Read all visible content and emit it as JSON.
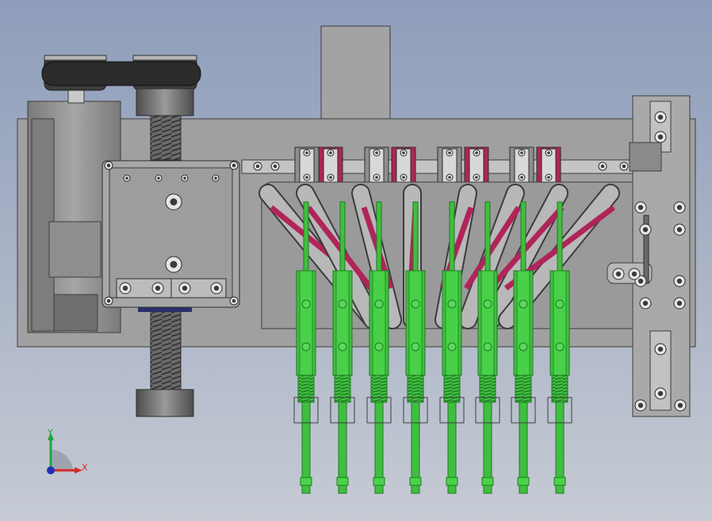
{
  "viewport": {
    "background_top": "#8e9dba",
    "background_bottom": "#c6cbd4"
  },
  "model": {
    "part_gray": "#9c9c9c",
    "dark_gray": "#5c5c5c",
    "steel": "#b3b3b3",
    "slot_pink": "#b0245a",
    "finger_green": "#3fbf3f",
    "finger_dark": "#1f7a22",
    "finger_count": 8
  },
  "triad": {
    "x_label": "X",
    "y_label": "Y",
    "x_color": "#d42a2a",
    "y_color": "#1fa83a",
    "z_color": "#1e2fb5"
  }
}
